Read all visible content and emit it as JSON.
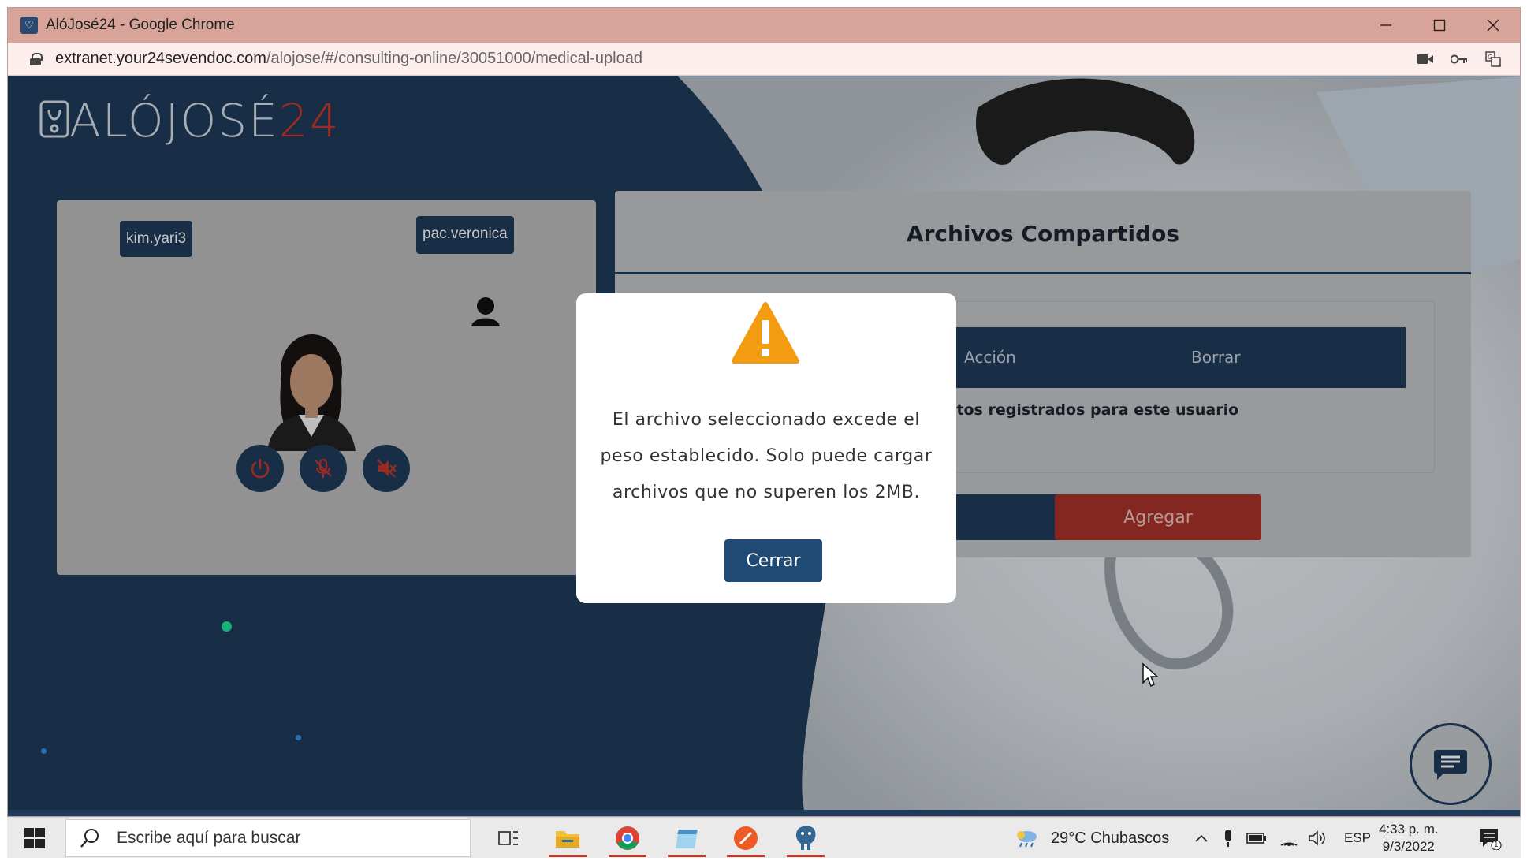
{
  "window": {
    "title": "AlóJosé24 - Google Chrome",
    "url_host": "extranet.your24sevendoc.com",
    "url_path": "/alojose/#/consulting-online/30051000/medical-upload"
  },
  "logo": {
    "text": "ALÓJOSÉ",
    "number": "24"
  },
  "video": {
    "doctor_tag": "kim.yari3",
    "patient_tag": "pac.veronica"
  },
  "files": {
    "title": "Archivos Compartidos",
    "col_action": "Acción",
    "col_delete": "Borrar",
    "empty_message": "datos registrados para este usuario",
    "add_button": "Agregar"
  },
  "modal": {
    "message": "El archivo seleccionado excede el peso establecido. Solo puede cargar archivos que no superen los 2MB.",
    "close_button": "Cerrar"
  },
  "taskbar": {
    "search_placeholder": "Escribe aquí para buscar",
    "weather": "29°C  Chubascos",
    "language": "ESP",
    "time": "4:33 p. m.",
    "date": "9/3/2022",
    "notifications": "1"
  },
  "colors": {
    "navy": "#1f3b5a",
    "danger": "#a8322a",
    "warning": "#f39c12"
  }
}
